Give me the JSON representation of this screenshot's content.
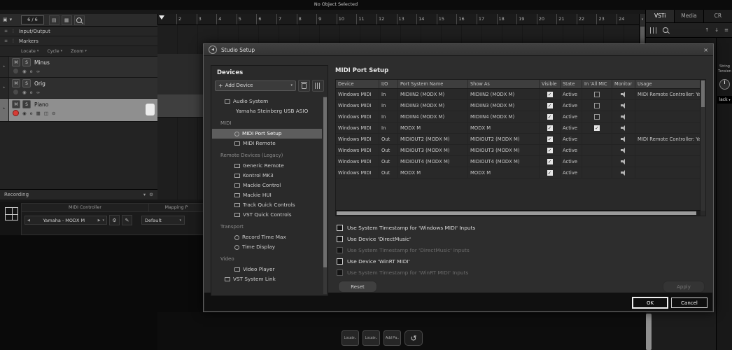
{
  "icons": {
    "add": "+",
    "caret_down": "▾",
    "left_arrow": "◀",
    "right_arrow": "▶",
    "close": "×",
    "back": "◀",
    "gear": "⚙",
    "pencil": "✎",
    "undo": "↺",
    "menu": "≡",
    "up": "↑",
    "down": "↓",
    "list": "▤",
    "grid": "▦",
    "panel": "▣",
    "speaker": "◉",
    "cycle": "∞",
    "keys": "▦",
    "io": "◫",
    "freeze": "⊖",
    "dots": "⋮",
    "note": "♪"
  },
  "top_bar": {
    "status": "No Object Selected"
  },
  "left_panel": {
    "counter": "6 / 6",
    "io_label": "Input/Output",
    "markers_label": "Markers",
    "marker_controls": [
      {
        "label": "Locate"
      },
      {
        "label": "Cycle"
      },
      {
        "label": "Zoom"
      }
    ],
    "track_buttons": {
      "mute": "M",
      "solo": "S",
      "edit": "e"
    },
    "tracks": [
      {
        "name": "Minus"
      },
      {
        "name": "Orig"
      },
      {
        "name": "Piano",
        "selected": true
      }
    ],
    "recording_label": "Recording"
  },
  "ruler": {
    "numbers": [
      "2",
      "3",
      "4",
      "5",
      "6",
      "7",
      "8",
      "9",
      "10",
      "11",
      "12",
      "13",
      "14",
      "15",
      "16",
      "17",
      "18",
      "19",
      "20",
      "21",
      "22",
      "23",
      "24"
    ]
  },
  "right_panel": {
    "tabs": [
      {
        "label": "VSTi",
        "active": true
      },
      {
        "label": "Media"
      },
      {
        "label": "CR"
      }
    ],
    "side_label_top": "String",
    "side_label_bottom": "Tension",
    "side_dropdown": "lack"
  },
  "lower_left": {
    "midi_controller_header": "MIDI Controller",
    "midi_controller_value": "Yamaha - MODX M",
    "mapping_header": "Mapping P",
    "mapping_value": "Default"
  },
  "bottom_buttons": [
    {
      "label": "Locate.."
    },
    {
      "label": "Locate.."
    },
    {
      "label": "Add Pa.."
    }
  ],
  "dialog": {
    "title": "Studio Setup",
    "devices": {
      "header": "Devices",
      "add_device": "Add Device",
      "tree": [
        {
          "label": "Audio System"
        },
        {
          "label": "Yamaha Steinberg USB ASIO"
        },
        {
          "label": "MIDI"
        },
        {
          "label": "MIDI Port Setup"
        },
        {
          "label": "MIDI Remote"
        },
        {
          "label": "Remote Devices (Legacy)"
        },
        {
          "label": "Generic Remote"
        },
        {
          "label": "Kontrol MK3"
        },
        {
          "label": "Mackie Control"
        },
        {
          "label": "Mackie HUI"
        },
        {
          "label": "Track Quick Controls"
        },
        {
          "label": "VST Quick Controls"
        },
        {
          "label": "Transport"
        },
        {
          "label": "Record Time Max"
        },
        {
          "label": "Time Display"
        },
        {
          "label": "Video"
        },
        {
          "label": "Video Player"
        },
        {
          "label": "VST System Link"
        }
      ]
    },
    "port_setup": {
      "title": "MIDI Port Setup",
      "columns": [
        {
          "label": "Device"
        },
        {
          "label": "I/O"
        },
        {
          "label": "Port System Name"
        },
        {
          "label": "Show As"
        },
        {
          "label": "Visible"
        },
        {
          "label": "State"
        },
        {
          "label": "In 'All MIC"
        },
        {
          "label": "Monitor"
        },
        {
          "label": "Usage"
        }
      ],
      "rows": [
        {
          "device": "Windows MIDI",
          "io": "In",
          "port": "MIDIIN2 (MODX M)",
          "show_as": "MIDIIN2 (MODX M)",
          "visible": true,
          "state": "Active",
          "in_all_box": true,
          "in_all_checked": false,
          "usage": "MIDI Remote Controller: Yam"
        },
        {
          "device": "Windows MIDI",
          "io": "In",
          "port": "MIDIIN3 (MODX M)",
          "show_as": "MIDIIN3 (MODX M)",
          "visible": true,
          "state": "Active",
          "in_all_box": true,
          "in_all_checked": false,
          "usage": ""
        },
        {
          "device": "Windows MIDI",
          "io": "In",
          "port": "MIDIIN4 (MODX M)",
          "show_as": "MIDIIN4 (MODX M)",
          "visible": true,
          "state": "Active",
          "in_all_box": true,
          "in_all_checked": false,
          "usage": ""
        },
        {
          "device": "Windows MIDI",
          "io": "In",
          "port": "MODX M",
          "show_as": "MODX M",
          "visible": true,
          "state": "Active",
          "in_all_box": true,
          "in_all_checked": true,
          "usage": ""
        },
        {
          "device": "Windows MIDI",
          "io": "Out",
          "port": "MIDIOUT2 (MODX M)",
          "show_as": "MIDIOUT2 (MODX M)",
          "visible": true,
          "state": "Active",
          "in_all_box": false,
          "in_all_checked": false,
          "usage": "MIDI Remote Controller: Yam"
        },
        {
          "device": "Windows MIDI",
          "io": "Out",
          "port": "MIDIOUT3 (MODX M)",
          "show_as": "MIDIOUT3 (MODX M)",
          "visible": true,
          "state": "Active",
          "in_all_box": false,
          "in_all_checked": false,
          "usage": ""
        },
        {
          "device": "Windows MIDI",
          "io": "Out",
          "port": "MIDIOUT4 (MODX M)",
          "show_as": "MIDIOUT4 (MODX M)",
          "visible": true,
          "state": "Active",
          "in_all_box": false,
          "in_all_checked": false,
          "usage": ""
        },
        {
          "device": "Windows MIDI",
          "io": "Out",
          "port": "MODX M",
          "show_as": "MODX M",
          "visible": true,
          "state": "Active",
          "in_all_box": false,
          "in_all_checked": false,
          "usage": ""
        }
      ],
      "options": [
        {
          "label": "Use System Timestamp for 'Windows MIDI' Inputs",
          "checked": false,
          "disabled": false
        },
        {
          "label": "Use Device 'DirectMusic'",
          "checked": false,
          "disabled": false
        },
        {
          "label": "Use System Timestamp for 'DirectMusic' Inputs",
          "checked": false,
          "disabled": true
        },
        {
          "label": "Use Device 'WinRT MIDI'",
          "checked": false,
          "disabled": false
        },
        {
          "label": "Use System Timestamp for 'WinRT MIDI' Inputs",
          "checked": false,
          "disabled": true
        }
      ],
      "reset_label": "Reset",
      "apply_label": "Apply"
    },
    "ok_label": "OK",
    "cancel_label": "Cancel"
  }
}
